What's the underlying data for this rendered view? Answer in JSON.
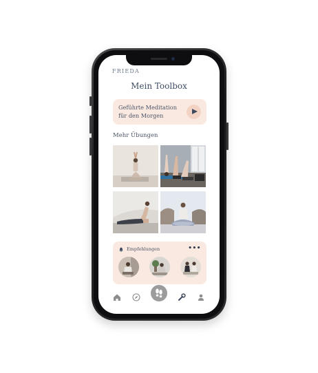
{
  "app": {
    "brand": "FRIEDA",
    "title": "Mein Toolbox"
  },
  "hero": {
    "line1": "Geführte Meditation",
    "line2": "für den Morgen",
    "play_icon": "play-icon"
  },
  "exercises": {
    "label": "Mehr Übungen",
    "tiles": [
      {
        "name": "yoga-standing-stretch"
      },
      {
        "name": "yoga-class-stretch"
      },
      {
        "name": "yoga-cobra-pose"
      },
      {
        "name": "meditation-outdoor"
      }
    ]
  },
  "recommendations": {
    "label": "Empfehlungen",
    "more": "•••",
    "bell_icon": "bell-icon",
    "items": [
      {
        "name": "recommendation-1"
      },
      {
        "name": "recommendation-2"
      },
      {
        "name": "recommendation-3"
      }
    ]
  },
  "tabbar": {
    "items": [
      "home-icon",
      "compass-icon",
      "footprints-icon",
      "wrench-icon",
      "user-icon"
    ]
  },
  "colors": {
    "accent_peach": "#fae9e1",
    "play_circle": "#f3d3c4",
    "text_navy": "#3f4d63",
    "tab_gray": "#9c9c9c"
  }
}
